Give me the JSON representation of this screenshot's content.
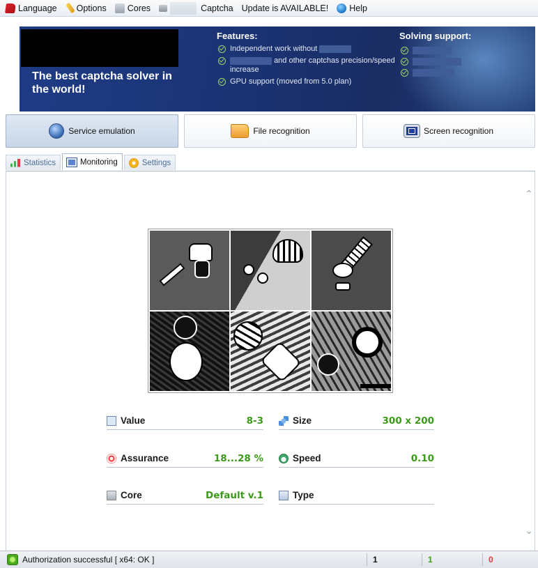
{
  "menu": {
    "language": "Language",
    "options": "Options",
    "cores": "Cores",
    "captcha": "Captcha",
    "update": "Update is AVAILABLE!",
    "help": "Help"
  },
  "banner": {
    "tagline": "The best captcha solver in the world!",
    "features_title": "Features:",
    "features": [
      "Independent work without",
      "and other captchas precision/speed increase",
      "GPU support (moved from 5.0 plan)"
    ],
    "solving_title": "Solving support:"
  },
  "modes": {
    "service": "Service emulation",
    "file": "File recognition",
    "screen": "Screen recognition"
  },
  "tabs": {
    "statistics": "Statistics",
    "monitoring": "Monitoring",
    "settings": "Settings"
  },
  "info": {
    "value_label": "Value",
    "value": "8-3",
    "size_label": "Size",
    "size": "300 x 200",
    "assurance_label": "Assurance",
    "assurance": "18...28 %",
    "speed_label": "Speed",
    "speed": "0.10",
    "core_label": "Core",
    "core": "Default v.1",
    "type_label": "Type",
    "type": ""
  },
  "status": {
    "text": "Authorization successful [ x64: OK ]",
    "count1": "1",
    "count2": "1",
    "count3": "0"
  },
  "colors": {
    "banner": "#1e3b85",
    "value_green": "#3c9a1a",
    "count_red": "#e23a3a",
    "tab_text": "#4b6d9a"
  }
}
